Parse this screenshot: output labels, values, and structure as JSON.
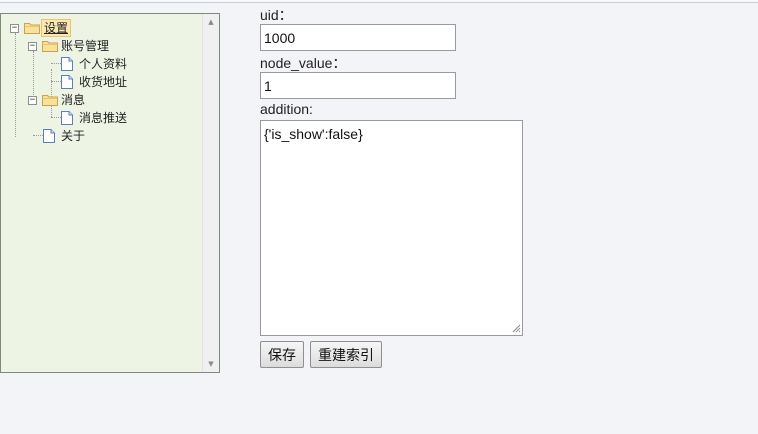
{
  "tree": {
    "root": {
      "label": "设置",
      "toggle": "⊟"
    },
    "account": {
      "label": "账号管理",
      "toggle": "⊟"
    },
    "profile": {
      "label": "个人资料"
    },
    "address": {
      "label": "收货地址"
    },
    "messages": {
      "label": "消息",
      "toggle": "⊟"
    },
    "push": {
      "label": "消息推送"
    },
    "about": {
      "label": "关于"
    },
    "scroll_up": "▲",
    "scroll_down": "▼"
  },
  "form": {
    "uid_label": "uid：",
    "uid_value": "1000",
    "node_value_label": "node_value：",
    "node_value_value": "1",
    "addition_label": "addition:",
    "addition_value": "{'is_show':false}",
    "save_label": "保存",
    "reindex_label": "重建索引"
  },
  "colors": {
    "tree_background": "#eef4e4",
    "selected_background": "#fde7b0",
    "folder": "#f5d67a"
  }
}
